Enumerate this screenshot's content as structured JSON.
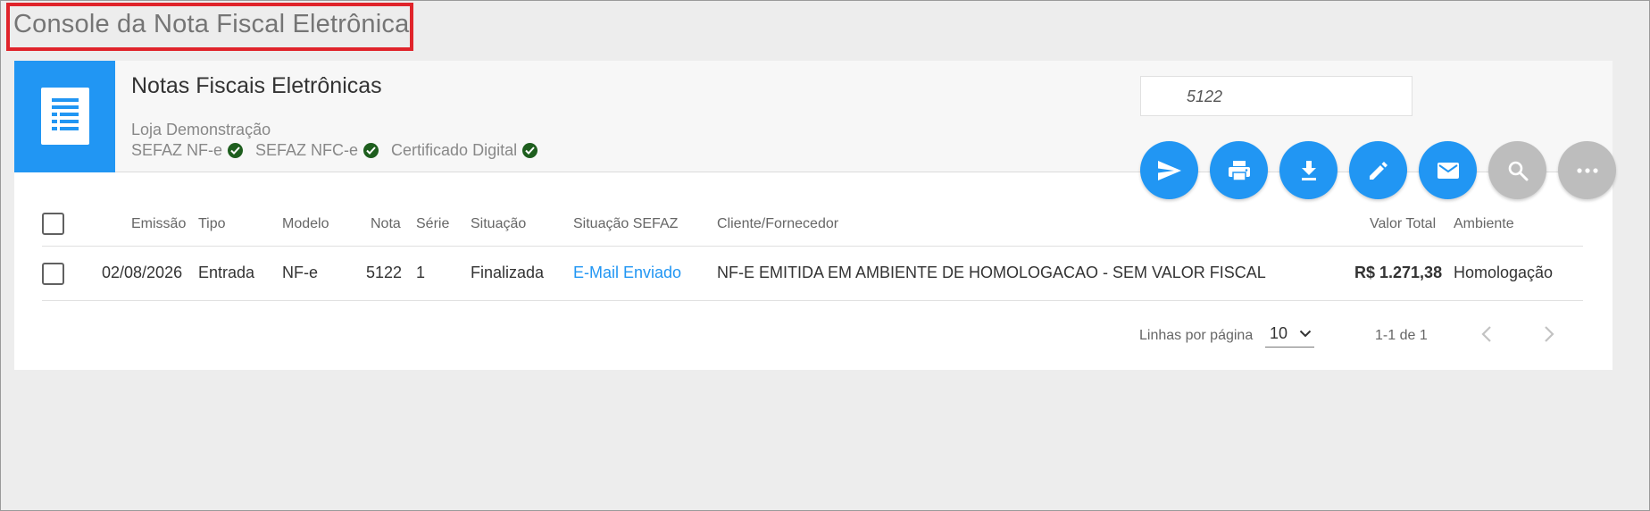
{
  "page": {
    "title": "Console da Nota Fiscal Eletrônica"
  },
  "header": {
    "title": "Notas Fiscais Eletrônicas",
    "store": "Loja Demonstração",
    "status": [
      {
        "label": "SEFAZ NF-e",
        "ok": true
      },
      {
        "label": "SEFAZ NFC-e",
        "ok": true
      },
      {
        "label": "Certificado Digital",
        "ok": true
      }
    ],
    "search_value": "5122"
  },
  "actions": [
    {
      "name": "send-icon",
      "color": "#2196f3"
    },
    {
      "name": "print-icon",
      "color": "#2196f3"
    },
    {
      "name": "download-icon",
      "color": "#2196f3"
    },
    {
      "name": "edit-icon",
      "color": "#2196f3"
    },
    {
      "name": "mail-icon",
      "color": "#2196f3"
    },
    {
      "name": "search-icon",
      "color": "#bdbdbd"
    },
    {
      "name": "more-icon",
      "color": "#bdbdbd"
    }
  ],
  "table": {
    "columns": {
      "emissao": "Emissão",
      "tipo": "Tipo",
      "modelo": "Modelo",
      "nota": "Nota",
      "serie": "Série",
      "situacao": "Situação",
      "situacao_sefaz": "Situação SEFAZ",
      "cliente": "Cliente/Fornecedor",
      "valor": "Valor Total",
      "ambiente": "Ambiente"
    },
    "rows": [
      {
        "emissao": "02/08/2026",
        "tipo": "Entrada",
        "modelo": "NF-e",
        "nota": "5122",
        "serie": "1",
        "situacao": "Finalizada",
        "situacao_sefaz": "E-Mail Enviado",
        "cliente": "NF-E EMITIDA EM AMBIENTE DE HOMOLOGACAO - SEM VALOR FISCAL",
        "valor": "R$ 1.271,38",
        "ambiente": "Homologação"
      }
    ]
  },
  "pagination": {
    "rows_label": "Linhas por página",
    "rows_value": "10",
    "range": "1-1 de 1"
  },
  "colors": {
    "accent": "#2196f3",
    "highlight": "#e0242b",
    "ok": "#1e5e1e"
  }
}
